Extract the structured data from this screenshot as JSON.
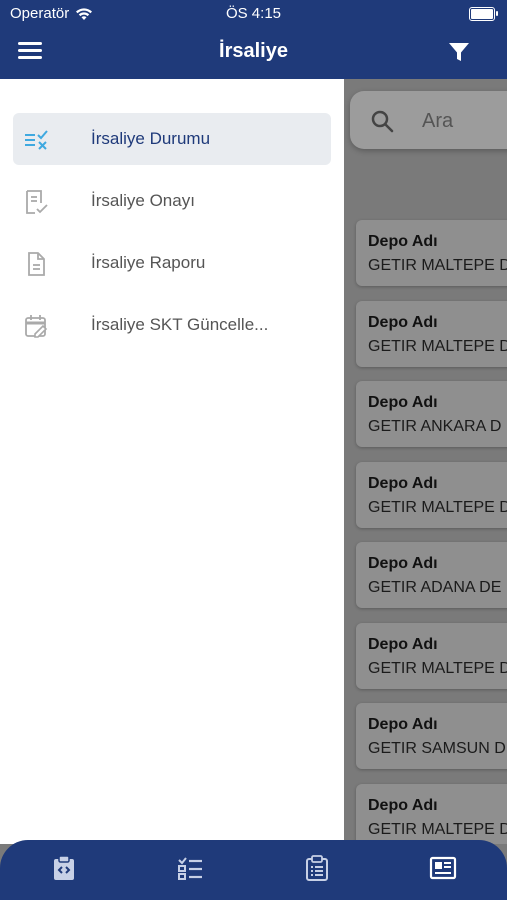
{
  "status_bar": {
    "carrier": "Operatör",
    "time": "ÖS 4:15"
  },
  "header": {
    "title": "İrsaliye",
    "menu_icon": "hamburger-icon",
    "filter_icon": "filter-icon",
    "color": "#1f3a7a"
  },
  "drawer": {
    "items": [
      {
        "label": "İrsaliye Durumu",
        "icon": "list-check-icon",
        "active": true
      },
      {
        "label": "İrsaliye Onayı",
        "icon": "document-check-icon",
        "active": false
      },
      {
        "label": "İrsaliye Raporu",
        "icon": "document-icon",
        "active": false
      },
      {
        "label": "İrsaliye SKT Güncelle...",
        "icon": "calendar-edit-icon",
        "active": false
      }
    ]
  },
  "search": {
    "placeholder": "Ara"
  },
  "cards": [
    {
      "title": "Depo Adı",
      "value": "GETIR MALTEPE D"
    },
    {
      "title": "Depo Adı",
      "value": "GETIR MALTEPE D"
    },
    {
      "title": "Depo Adı",
      "value": "GETIR ANKARA D"
    },
    {
      "title": "Depo Adı",
      "value": "GETIR MALTEPE D"
    },
    {
      "title": "Depo Adı",
      "value": "GETIR ADANA DE"
    },
    {
      "title": "Depo Adı",
      "value": "GETIR MALTEPE D"
    },
    {
      "title": "Depo Adı",
      "value": "GETIR SAMSUN D"
    },
    {
      "title": "Depo Adı",
      "value": "GETIR MALTEPE D"
    }
  ],
  "tab_bar": {
    "tabs": [
      {
        "icon": "clipboard-code-icon"
      },
      {
        "icon": "checklist-icon"
      },
      {
        "icon": "clipboard-list-icon"
      },
      {
        "icon": "newspaper-icon",
        "active": true
      }
    ]
  }
}
